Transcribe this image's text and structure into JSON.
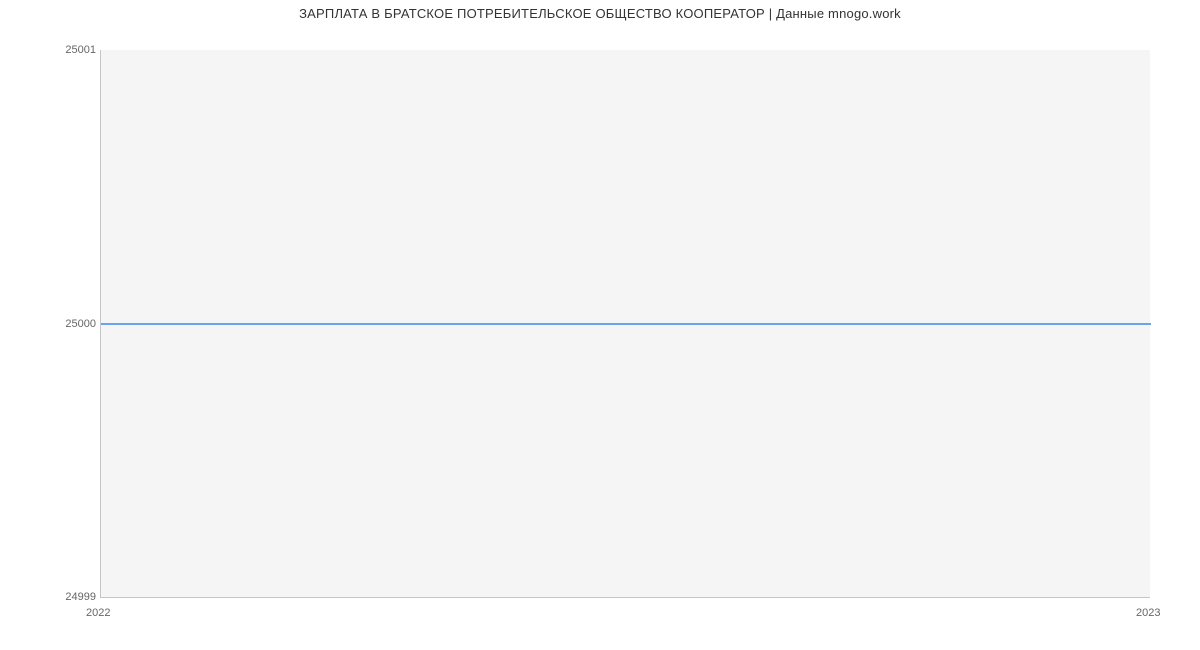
{
  "chart_data": {
    "type": "line",
    "title": "ЗАРПЛАТА В БРАТСКОЕ ПОТРЕБИТЕЛЬСКОЕ ОБЩЕСТВО КООПЕРАТОР | Данные mnogo.work",
    "xlabel": "",
    "ylabel": "",
    "x": [
      2022,
      2023
    ],
    "series": [
      {
        "name": "salary",
        "values": [
          25000,
          25000
        ],
        "color": "#6aa4e8"
      }
    ],
    "y_ticks": [
      24999,
      25000,
      25001
    ],
    "x_ticks": [
      2022,
      2023
    ],
    "ylim": [
      24999,
      25001
    ],
    "xlim": [
      2022,
      2023
    ]
  },
  "ticks": {
    "y0": "24999",
    "y1": "25000",
    "y2": "25001",
    "x0": "2022",
    "x1": "2023"
  }
}
